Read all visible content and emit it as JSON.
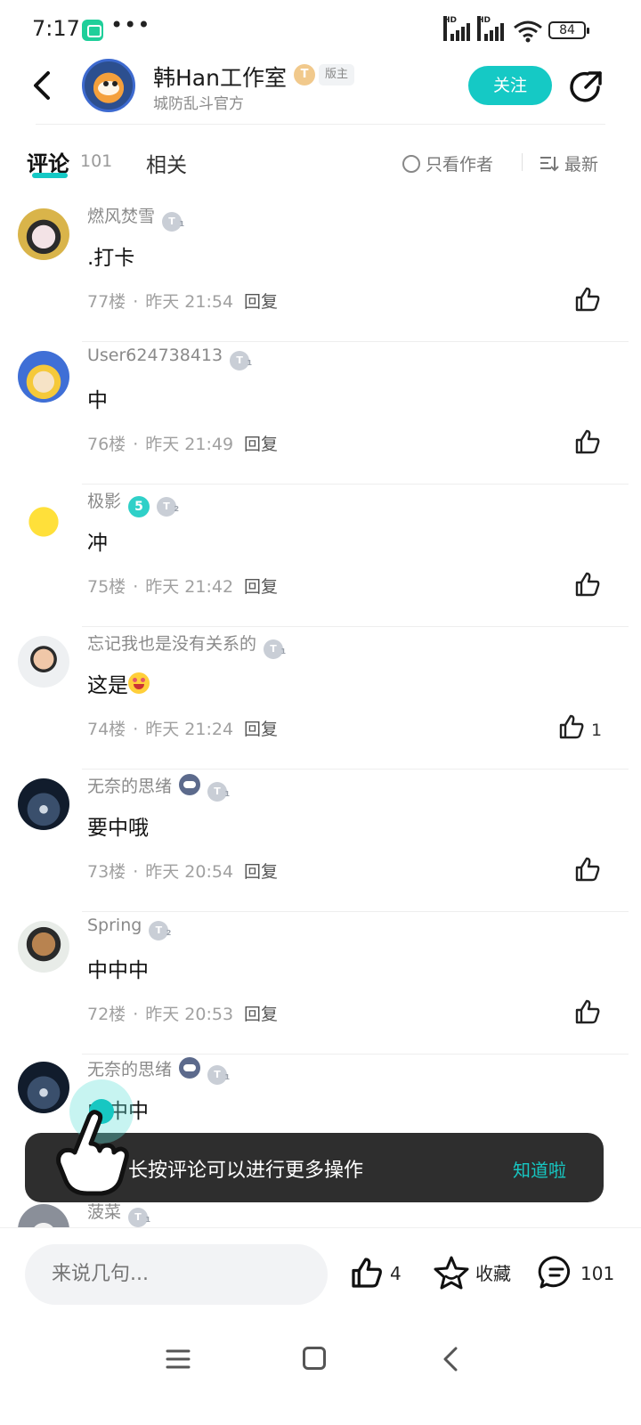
{
  "status_bar": {
    "time": "7:17",
    "dots": "•••",
    "battery": "84",
    "hd_label": "HD"
  },
  "header": {
    "title": "韩Han工作室",
    "badge_level": "T",
    "moderator_tag": "版主",
    "subtitle": "城防乱斗官方",
    "follow_label": "关注"
  },
  "tabs": {
    "comments_label": "评论",
    "comments_count": "101",
    "related_label": "相关",
    "author_only_label": "只看作者",
    "sort_label": "最新"
  },
  "comments": [
    {
      "name": "燃风焚雪",
      "level": "1",
      "content": ".打卡",
      "floor": "77楼",
      "time": "昨天 21:54",
      "reply": "回复",
      "likes": ""
    },
    {
      "name": "User624738413",
      "level": "1",
      "content": "中",
      "floor": "76楼",
      "time": "昨天 21:49",
      "reply": "回复",
      "likes": ""
    },
    {
      "name": "极影",
      "level": "2",
      "extra_badge": "5",
      "content": "冲",
      "floor": "75楼",
      "time": "昨天 21:42",
      "reply": "回复",
      "likes": ""
    },
    {
      "name": "忘记我也是没有关系的",
      "level": "1",
      "content": "这是",
      "floor": "74楼",
      "time": "昨天 21:24",
      "reply": "回复",
      "likes": "1"
    },
    {
      "name": "无奈的思绪",
      "level": "1",
      "content": "要中哦",
      "floor": "73楼",
      "time": "昨天 20:54",
      "reply": "回复",
      "likes": ""
    },
    {
      "name": "Spring",
      "level": "2",
      "content": "中中中",
      "floor": "72楼",
      "time": "昨天 20:53",
      "reply": "回复",
      "likes": ""
    },
    {
      "name": "无奈的思绪",
      "level": "1",
      "content": "中中中",
      "floor": "",
      "time": "",
      "reply": "",
      "likes": ""
    },
    {
      "name": "菠菜",
      "level": "1",
      "content": "",
      "floor": "",
      "time": "",
      "reply": "",
      "likes": ""
    }
  ],
  "meta_dot": "·",
  "toast": {
    "text": "长按评论可以进行更多操作",
    "action": "知道啦"
  },
  "bottom_bar": {
    "input_placeholder": "来说几句...",
    "like_count": "4",
    "favorite_label": "收藏",
    "comment_count": "101"
  },
  "colors": {
    "accent": "#15c9c5",
    "toast_bg": "#2e2e2e",
    "muted_text": "#a0a0a0"
  }
}
